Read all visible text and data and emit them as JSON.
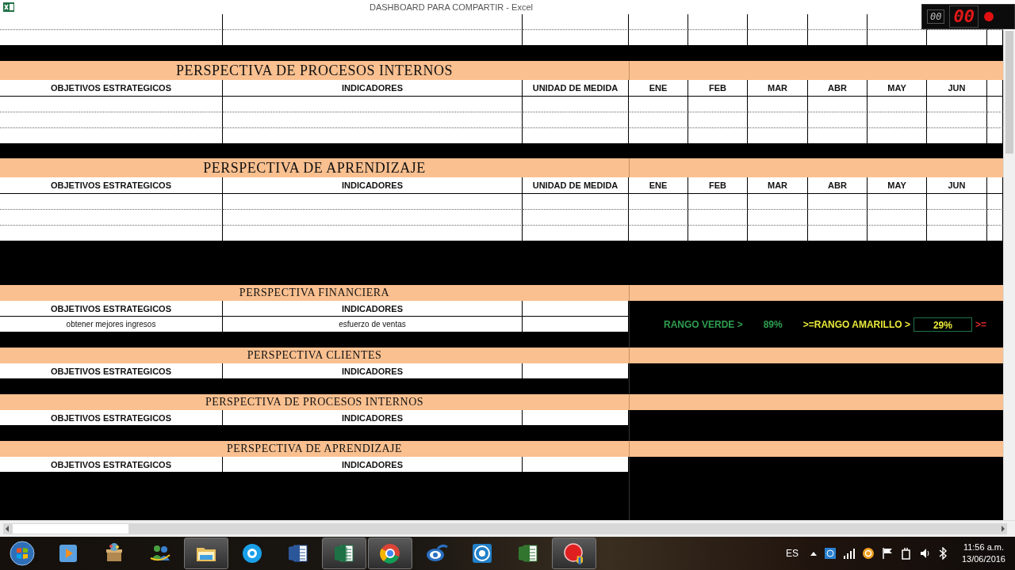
{
  "window": {
    "title": "DASHBOARD PARA COMPARTIR - Excel"
  },
  "recorder": {
    "small_counter": "00",
    "counter": "00"
  },
  "top_sections": [
    {
      "title": "PERSPECTIVA DE PROCESOS INTERNOS",
      "columns": [
        "OBJETIVOS ESTRATEGICOS",
        "INDICADORES",
        "UNIDAD DE MEDIDA",
        "ENE",
        "FEB",
        "MAR",
        "ABR",
        "MAY",
        "JUN"
      ]
    },
    {
      "title": "PERSPECTIVA DE APRENDIZAJE",
      "columns": [
        "OBJETIVOS ESTRATEGICOS",
        "INDICADORES",
        "UNIDAD DE MEDIDA",
        "ENE",
        "FEB",
        "MAR",
        "ABR",
        "MAY",
        "JUN"
      ]
    }
  ],
  "summary_sections": [
    {
      "title": "PERSPECTIVA FINANCIERA",
      "columns": [
        "OBJETIVOS ESTRATEGICOS",
        "INDICADORES"
      ],
      "rows": [
        [
          "obtener mejores ingresos",
          "esfuerzo de ventas"
        ]
      ],
      "ranges": [
        {
          "label": "RANGO VERDE >",
          "value": "89%",
          "color": "#2e9e50",
          "selected": false
        },
        {
          "label": ">=RANGO AMARILLO >",
          "value": "29%",
          "color": "#e8e83a",
          "selected": true
        },
        {
          "label": ">=",
          "color": "#e02828"
        }
      ]
    },
    {
      "title": "PERSPECTIVA CLIENTES",
      "columns": [
        "OBJETIVOS ESTRATEGICOS",
        "INDICADORES"
      ]
    },
    {
      "title": "PERSPECTIVA DE PROCESOS INTERNOS",
      "columns": [
        "OBJETIVOS ESTRATEGICOS",
        "INDICADORES"
      ]
    },
    {
      "title": "PERSPECTIVA DE APRENDIZAJE",
      "columns": [
        "OBJETIVOS ESTRATEGICOS",
        "INDICADORES"
      ]
    }
  ],
  "taskbar": {
    "apps": [
      {
        "kind": "media",
        "selected": false
      },
      {
        "kind": "box",
        "selected": false
      },
      {
        "kind": "people",
        "selected": false
      },
      {
        "kind": "folder",
        "selected": true
      },
      {
        "kind": "bubble",
        "selected": false
      },
      {
        "kind": "word",
        "selected": false
      },
      {
        "kind": "sheet",
        "selected": true
      },
      {
        "kind": "browser",
        "selected": true
      },
      {
        "kind": "eye",
        "selected": false
      },
      {
        "kind": "disc",
        "selected": false
      },
      {
        "kind": "project",
        "selected": false
      },
      {
        "kind": "record",
        "selected": true
      }
    ],
    "language": "ES",
    "time": "11:56 a.m.",
    "date": "13/06/2016"
  }
}
